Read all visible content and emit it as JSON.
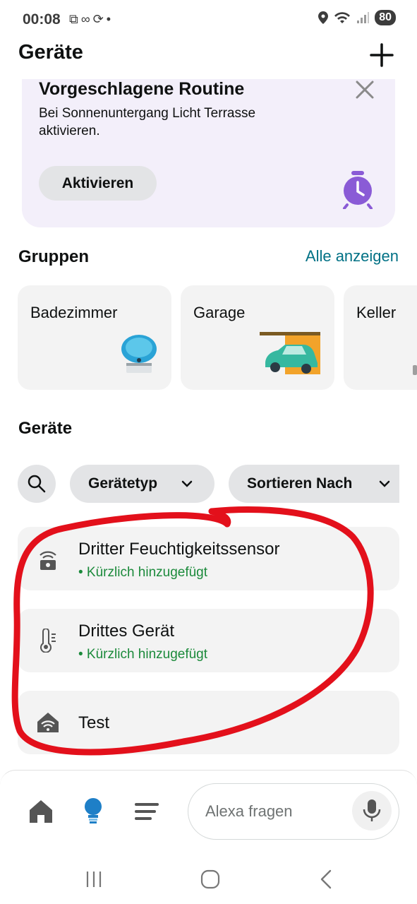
{
  "status_bar": {
    "time": "00:08",
    "battery": "80"
  },
  "header": {
    "title": "Geräte",
    "add_icon": "plus-icon"
  },
  "routine_card": {
    "title": "Vorgeschlagene Routine",
    "description": "Bei Sonnenuntergang Licht Terrasse aktivieren.",
    "activate_label": "Aktivieren",
    "close_icon": "close-icon",
    "illustration_icon": "alarm-clock-icon"
  },
  "groups": {
    "title": "Gruppen",
    "see_all_label": "Alle anzeigen",
    "items": [
      {
        "label": "Badezimmer",
        "icon": "echo-device-icon"
      },
      {
        "label": "Garage",
        "icon": "garage-car-icon"
      },
      {
        "label": "Keller",
        "icon": ""
      }
    ]
  },
  "devices": {
    "title": "Geräte",
    "filters": {
      "search_icon": "search-icon",
      "device_type_label": "Gerätetyp",
      "sort_label": "Sortieren Nach"
    },
    "items": [
      {
        "name": "Dritter Feuchtigkeitssensor",
        "status": "• Kürzlich hinzugefügt",
        "icon": "sensor-icon"
      },
      {
        "name": "Drittes Gerät",
        "status": "• Kürzlich hinzugefügt",
        "icon": "thermometer-icon"
      },
      {
        "name": "Test",
        "status": "",
        "icon": "wifi-house-icon"
      }
    ]
  },
  "bottom_nav": {
    "home_icon": "home-icon",
    "devices_icon": "lightbulb-icon",
    "more_icon": "menu-icon",
    "alexa_placeholder": "Alexa fragen",
    "mic_icon": "microphone-icon"
  },
  "colors": {
    "link": "#007185",
    "recently_added": "#1b8a3b",
    "routine_bg": "#f3effa",
    "card_bg": "#f3f3f3",
    "chip_bg": "#e3e4e6",
    "accent_purple": "#8a5bd6",
    "annotation_red": "#e3101b"
  }
}
